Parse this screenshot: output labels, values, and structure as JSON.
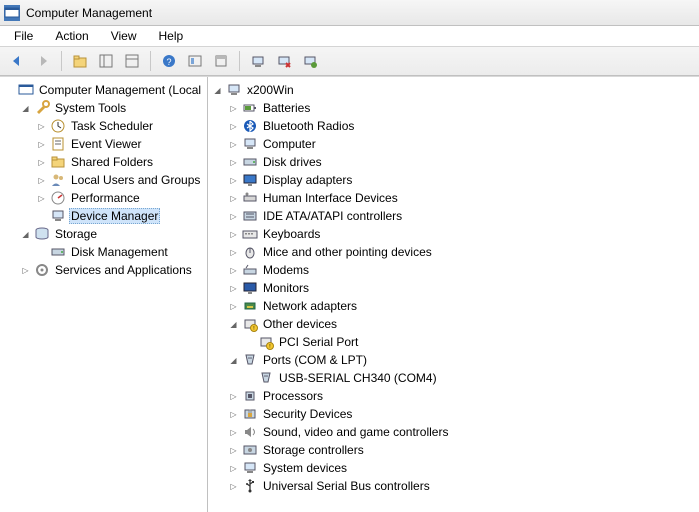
{
  "window": {
    "title": "Computer Management"
  },
  "menu": {
    "file": "File",
    "action": "Action",
    "view": "View",
    "help": "Help"
  },
  "left_tree": {
    "root": "Computer Management (Local",
    "system_tools": "System Tools",
    "task_scheduler": "Task Scheduler",
    "event_viewer": "Event Viewer",
    "shared_folders": "Shared Folders",
    "local_users": "Local Users and Groups",
    "performance": "Performance",
    "device_manager": "Device Manager",
    "storage": "Storage",
    "disk_management": "Disk Management",
    "services_apps": "Services and Applications"
  },
  "right_tree": {
    "computer": "x200Win",
    "batteries": "Batteries",
    "bluetooth": "Bluetooth Radios",
    "computer_cat": "Computer",
    "disk_drives": "Disk drives",
    "display_adapters": "Display adapters",
    "hid": "Human Interface Devices",
    "ide": "IDE ATA/ATAPI controllers",
    "keyboards": "Keyboards",
    "mice": "Mice and other pointing devices",
    "modems": "Modems",
    "monitors": "Monitors",
    "network": "Network adapters",
    "other_devices": "Other devices",
    "pci_serial": "PCI Serial Port",
    "ports": "Ports (COM & LPT)",
    "usb_serial_ch340": "USB-SERIAL CH340 (COM4)",
    "processors": "Processors",
    "security": "Security Devices",
    "sound": "Sound, video and game controllers",
    "storage_ctrl": "Storage controllers",
    "system_devices": "System devices",
    "usb": "Universal Serial Bus controllers"
  }
}
